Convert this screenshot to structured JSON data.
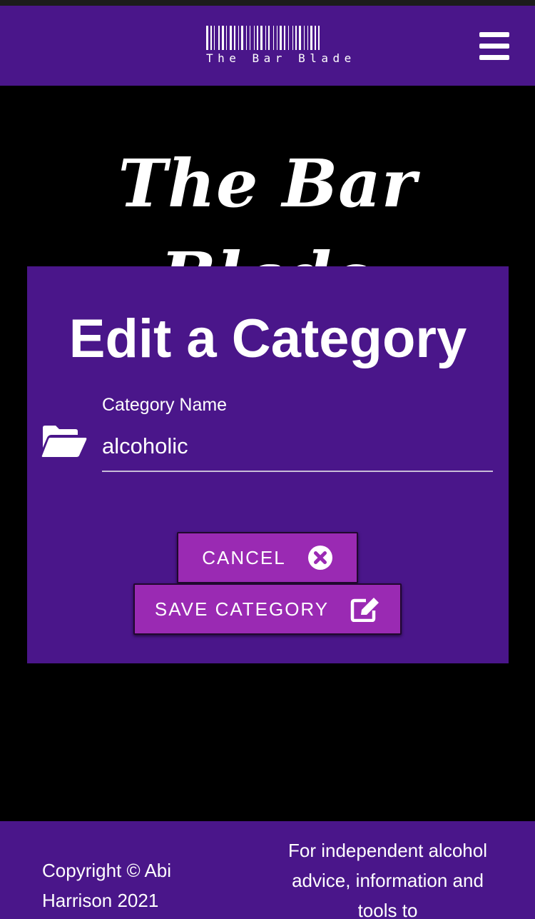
{
  "navbar": {
    "brand_text": "The Bar Blade",
    "menu_icon": "hamburger-icon",
    "logo_icon": "barcode-icon"
  },
  "hero": {
    "title": "The Bar Blade"
  },
  "form": {
    "title": "Edit a Category",
    "field_icon": "folder-open-icon",
    "field_label": "Category Name",
    "field_value": "alcoholic",
    "cancel_label": "CANCEL",
    "cancel_icon": "times-circle-icon",
    "save_label": "SAVE CATEGORY",
    "save_icon": "edit-icon"
  },
  "footer": {
    "copyright": "Copyright © Abi Harrison 2021",
    "tagline": "For independent alcohol advice, information and tools to"
  },
  "colors": {
    "primary": "#4a168a",
    "button": "#9a2ab3",
    "background": "#000000",
    "text": "#ffffff"
  }
}
